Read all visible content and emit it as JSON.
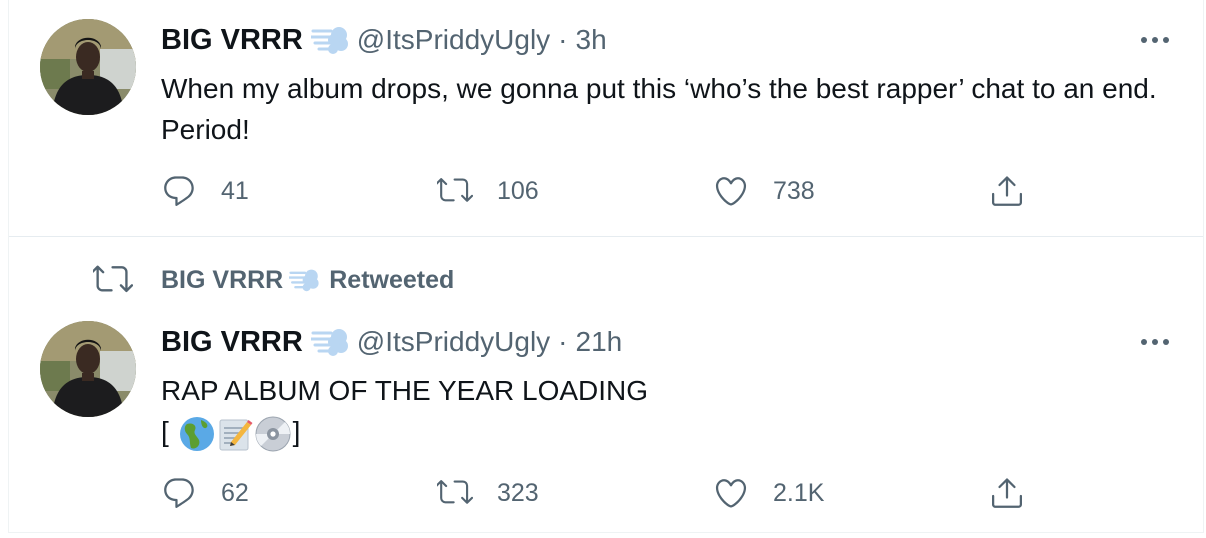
{
  "tweets": [
    {
      "author_name": "BIG VRRR",
      "author_name_emoji": "dash-icon",
      "handle": "@ItsPriddyUgly",
      "separator": "·",
      "time": "3h",
      "text": "When my album drops, we gonna put this ‘who’s the best rapper’ chat to an end. Period!",
      "replies": "41",
      "retweets": "106",
      "likes": "738"
    },
    {
      "retweet_context": {
        "name": "BIG VRRR",
        "label": "Retweeted"
      },
      "author_name": "BIG VRRR",
      "author_name_emoji": "dash-icon",
      "handle": "@ItsPriddyUgly",
      "separator": "·",
      "time": "21h",
      "text_line1": "RAP ALBUM OF THE YEAR LOADING",
      "text_open": "[ ",
      "text_emojis": [
        "globe-icon",
        "memo-icon",
        "dvd-icon"
      ],
      "text_close": "]",
      "replies": "62",
      "retweets": "323",
      "likes": "2.1K"
    }
  ],
  "colors": {
    "text_primary": "#0f1419",
    "text_secondary": "#536471",
    "divider": "#e6ecf0"
  }
}
